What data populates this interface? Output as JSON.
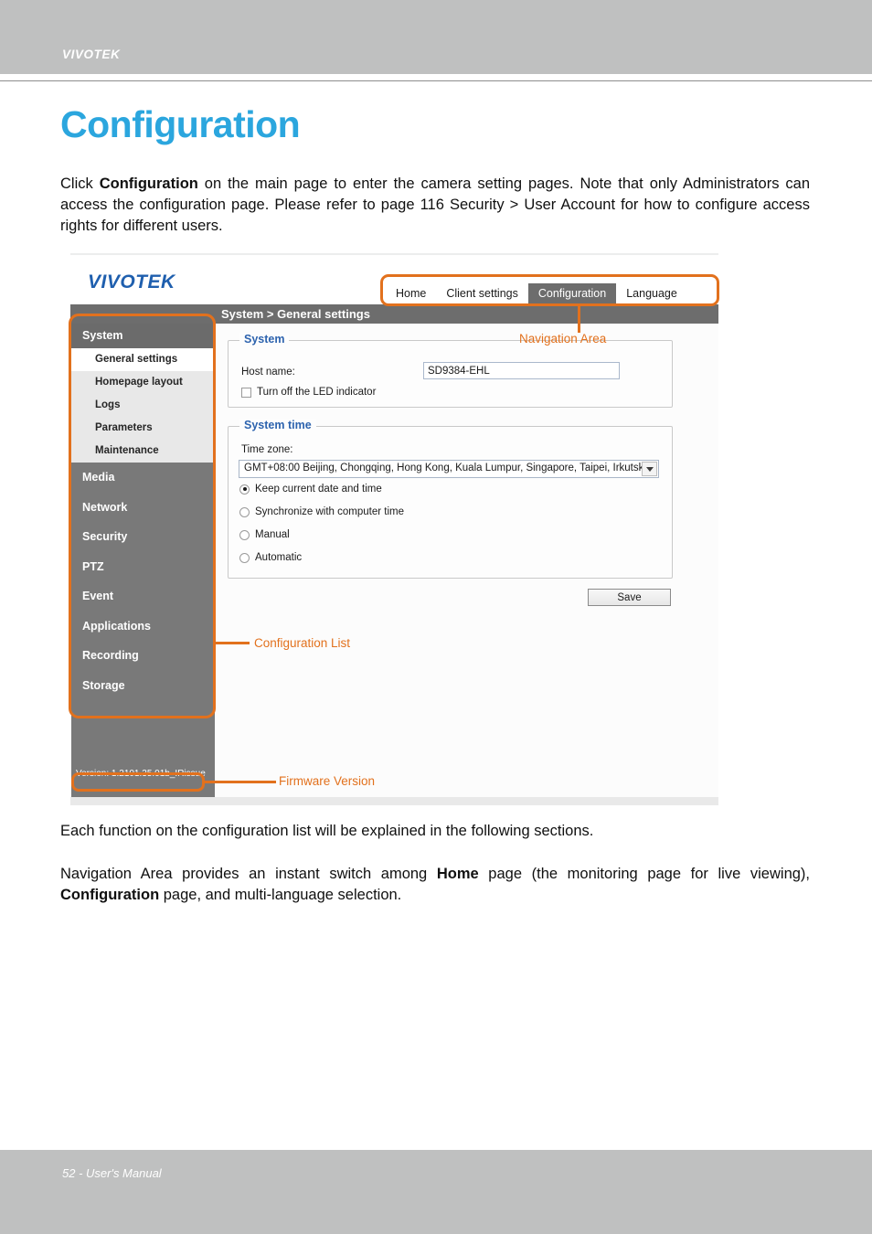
{
  "header": {
    "brand": "VIVOTEK"
  },
  "page": {
    "title": "Configuration",
    "intro_paragraph_html": "Click <b>Configuration</b> on the main page to enter the camera setting pages. Note that only Administrators can access the configuration page. Please refer to page 116 Security &gt; User Account for how to configure access rights for different users.",
    "each_function_paragraph_html": "Each function on the configuration list will be explained in the following sections.",
    "navigation_area_paragraph_html": "Navigation Area provides an instant switch among <b>Home</b> page (the monitoring page for live viewing), <b>Configuration</b> page, and multi-language selection."
  },
  "footer": {
    "text": "52 - User's Manual"
  },
  "screenshot": {
    "logo": "VIVOTEK",
    "nav_menu": [
      {
        "label": "Home",
        "active": false
      },
      {
        "label": "Client settings",
        "active": false
      },
      {
        "label": "Configuration",
        "active": true
      },
      {
        "label": "Language",
        "active": false
      }
    ],
    "breadcrumb": "System  > General settings",
    "sidebar": {
      "group_header": "System",
      "sub_items": [
        {
          "label": "General settings",
          "selected": true
        },
        {
          "label": "Homepage layout",
          "selected": false
        },
        {
          "label": "Logs",
          "selected": false
        },
        {
          "label": "Parameters",
          "selected": false
        },
        {
          "label": "Maintenance",
          "selected": false
        }
      ],
      "main_items": [
        "Media",
        "Network",
        "Security",
        "PTZ",
        "Event",
        "Applications",
        "Recording",
        "Storage"
      ],
      "version": "Version: 1.2101.35.01b_IRissue"
    },
    "system_panel": {
      "legend": "System",
      "host_name_label": "Host name:",
      "host_name_value": "SD9384-EHL",
      "host_name_placeholder": "",
      "led_checkbox_label": "Turn off the LED indicator",
      "led_checkbox_checked": false
    },
    "system_time_panel": {
      "legend": "System time",
      "time_zone_label": "Time zone:",
      "time_zone_selected": "GMT+08:00 Beijing, Chongqing, Hong Kong, Kuala Lumpur, Singapore, Taipei, Irkutsk",
      "dropdown_icon": "chevron-down-icon",
      "radio_options": [
        {
          "label": "Keep current date and time",
          "selected": true
        },
        {
          "label": "Synchronize with computer time",
          "selected": false
        },
        {
          "label": "Manual",
          "selected": false
        },
        {
          "label": "Automatic",
          "selected": false
        }
      ]
    },
    "save_button_label": "Save"
  },
  "annotations": {
    "navigation_area": "Navigation Area",
    "configuration_list": "Configuration List",
    "firmware_version": "Firmware Version"
  },
  "colors": {
    "accent_blue": "#2ba6de",
    "annotation_orange": "#e2711d",
    "header_gray": "#bfc0c0",
    "sidebar_gray": "#797979",
    "legend_blue": "#2d63ae"
  }
}
